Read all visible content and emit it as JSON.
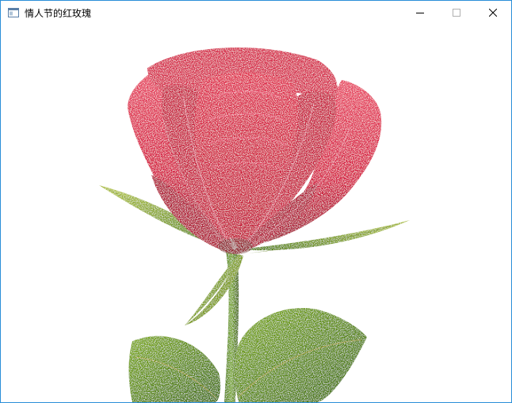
{
  "window": {
    "title": "情人节的红玫瑰",
    "icon": "app-window-icon",
    "border_color": "#2b8fd8"
  },
  "caption_buttons": {
    "minimize_icon": "minimize-icon",
    "maximize_icon": "maximize-icon",
    "close_icon": "close-icon"
  },
  "canvas": {
    "background": "#ffffff",
    "petal_color": "#d4173c",
    "petal_light": "#e8415e",
    "leaf_color": "#6a9a10",
    "leaf_dark": "#3d6b08",
    "sepal_color": "#8aa020"
  }
}
